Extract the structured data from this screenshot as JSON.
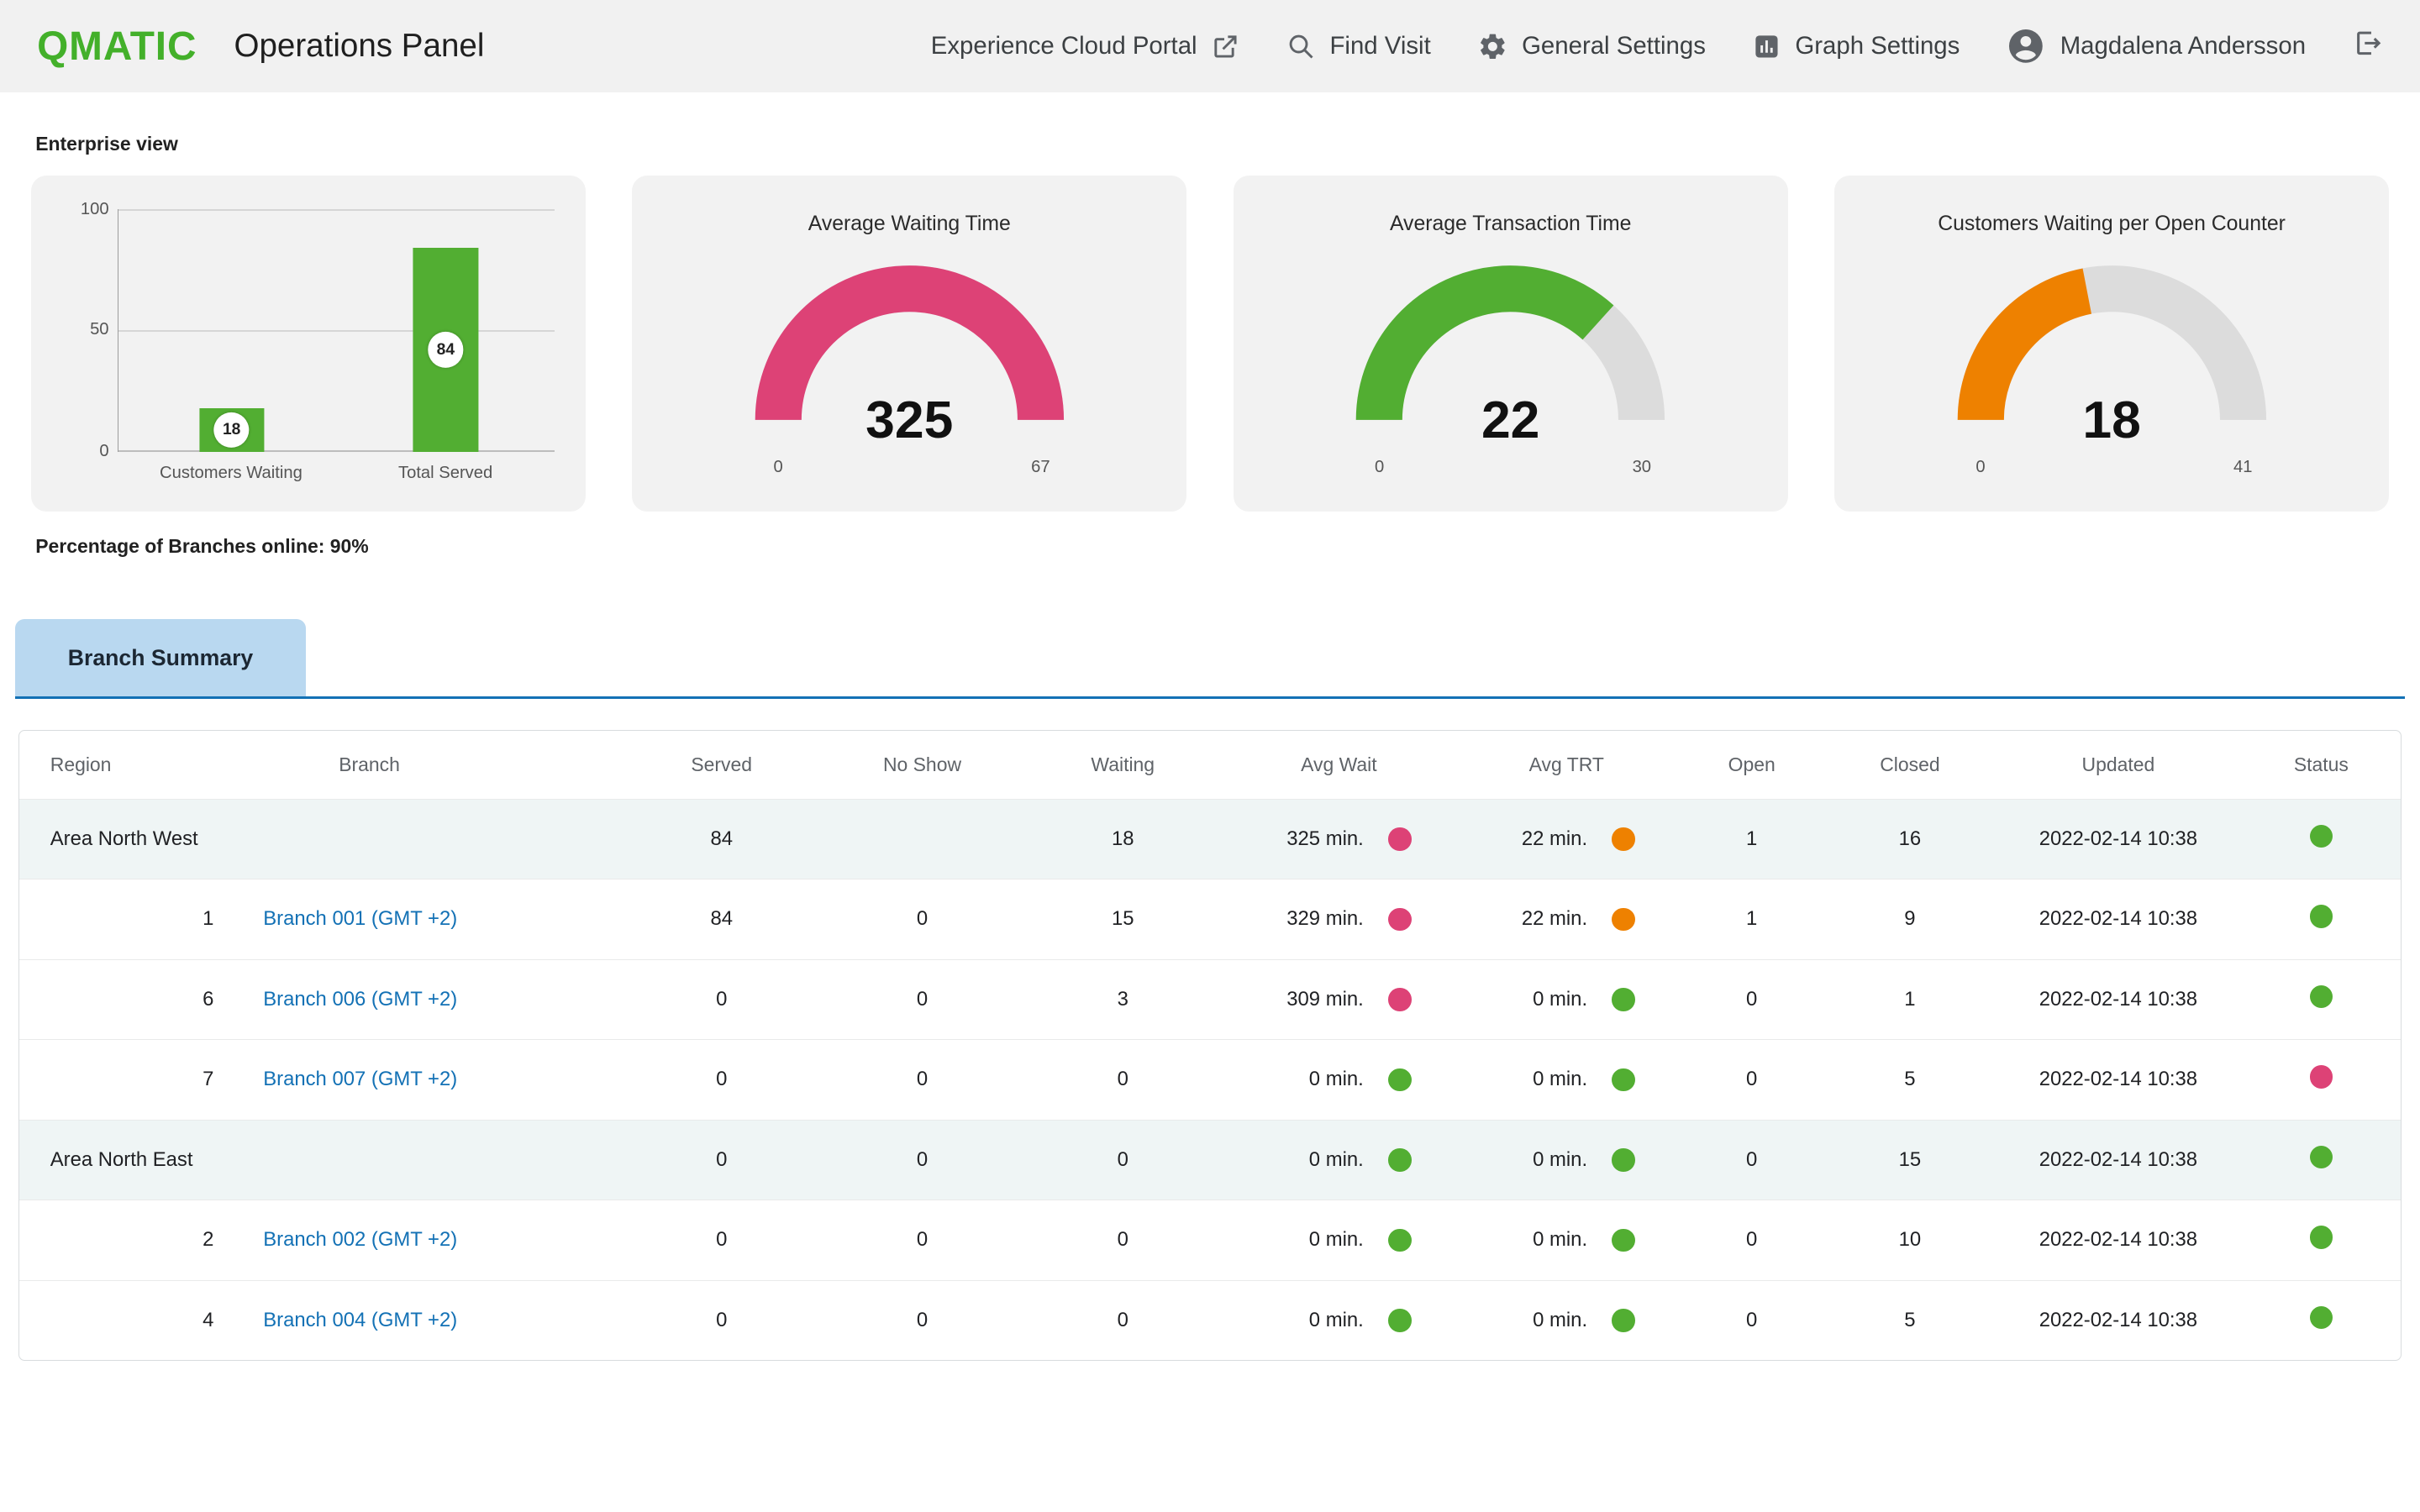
{
  "header": {
    "logo": "QMATIC",
    "title": "Operations Panel",
    "nav": [
      {
        "label": "Experience Cloud Portal",
        "icon": "external-link-icon"
      },
      {
        "label": "Find Visit",
        "icon": "search-icon"
      },
      {
        "label": "General Settings",
        "icon": "gear-icon"
      },
      {
        "label": "Graph Settings",
        "icon": "graph-settings-icon"
      }
    ],
    "user": {
      "name": "Magdalena Andersson",
      "icon": "avatar-icon"
    }
  },
  "enterprise": {
    "label": "Enterprise view",
    "online_label": "Percentage of Branches online: 90%"
  },
  "tabs": {
    "branch_summary": "Branch Summary"
  },
  "colors": {
    "brand_green": "#43b02a",
    "chart_green": "#52ae32",
    "pink": "#dd4276",
    "orange": "#ee8100",
    "link_blue": "#1371b5"
  },
  "chart_data": [
    {
      "type": "bar",
      "categories": [
        "Customers Waiting",
        "Total Served"
      ],
      "values": [
        18,
        84
      ],
      "yticks": [
        0,
        50,
        100
      ],
      "ylim": [
        0,
        100
      ],
      "bar_color": "#52ae32",
      "badges": [
        18,
        84
      ]
    },
    {
      "type": "gauge",
      "title": "Average Waiting Time",
      "value": 325,
      "min": 0,
      "max": 67,
      "color": "#dd4276"
    },
    {
      "type": "gauge",
      "title": "Average Transaction Time",
      "value": 22,
      "min": 0,
      "max": 30,
      "color": "#52ae32"
    },
    {
      "type": "gauge",
      "title": "Customers Waiting per Open Counter",
      "value": 18,
      "min": 0,
      "max": 41,
      "color": "#ee8100"
    }
  ],
  "table": {
    "columns": [
      "Region",
      "Branch",
      "Served",
      "No Show",
      "Waiting",
      "Avg Wait",
      "Avg TRT",
      "Open",
      "Closed",
      "Updated",
      "Status"
    ],
    "rows": [
      {
        "kind": "region",
        "region": "Area North West",
        "branch_no": "",
        "branch": "",
        "served": "84",
        "no_show": "",
        "waiting": "18",
        "avg_wait": "325 min.",
        "avg_wait_dot": "pink",
        "avg_trt": "22 min.",
        "avg_trt_dot": "orange",
        "open": "1",
        "closed": "16",
        "updated": "2022-02-14 10:38",
        "status_dot": "green"
      },
      {
        "kind": "branch",
        "region": "",
        "branch_no": "1",
        "branch": "Branch 001 (GMT +2)",
        "served": "84",
        "no_show": "0",
        "waiting": "15",
        "avg_wait": "329 min.",
        "avg_wait_dot": "pink",
        "avg_trt": "22 min.",
        "avg_trt_dot": "orange",
        "open": "1",
        "closed": "9",
        "updated": "2022-02-14 10:38",
        "status_dot": "green"
      },
      {
        "kind": "branch",
        "region": "",
        "branch_no": "6",
        "branch": "Branch 006 (GMT +2)",
        "served": "0",
        "no_show": "0",
        "waiting": "3",
        "avg_wait": "309 min.",
        "avg_wait_dot": "pink",
        "avg_trt": "0 min.",
        "avg_trt_dot": "green",
        "open": "0",
        "closed": "1",
        "updated": "2022-02-14 10:38",
        "status_dot": "green"
      },
      {
        "kind": "branch",
        "region": "",
        "branch_no": "7",
        "branch": "Branch 007 (GMT +2)",
        "served": "0",
        "no_show": "0",
        "waiting": "0",
        "avg_wait": "0 min.",
        "avg_wait_dot": "green",
        "avg_trt": "0 min.",
        "avg_trt_dot": "green",
        "open": "0",
        "closed": "5",
        "updated": "2022-02-14 10:38",
        "status_dot": "pink"
      },
      {
        "kind": "region",
        "region": "Area North East",
        "branch_no": "",
        "branch": "",
        "served": "0",
        "no_show": "0",
        "waiting": "0",
        "avg_wait": "0 min.",
        "avg_wait_dot": "green",
        "avg_trt": "0 min.",
        "avg_trt_dot": "green",
        "open": "0",
        "closed": "15",
        "updated": "2022-02-14 10:38",
        "status_dot": "green"
      },
      {
        "kind": "branch",
        "region": "",
        "branch_no": "2",
        "branch": "Branch 002 (GMT +2)",
        "served": "0",
        "no_show": "0",
        "waiting": "0",
        "avg_wait": "0 min.",
        "avg_wait_dot": "green",
        "avg_trt": "0 min.",
        "avg_trt_dot": "green",
        "open": "0",
        "closed": "10",
        "updated": "2022-02-14 10:38",
        "status_dot": "green"
      },
      {
        "kind": "branch",
        "region": "",
        "branch_no": "4",
        "branch": "Branch 004 (GMT +2)",
        "served": "0",
        "no_show": "0",
        "waiting": "0",
        "avg_wait": "0 min.",
        "avg_wait_dot": "green",
        "avg_trt": "0 min.",
        "avg_trt_dot": "green",
        "open": "0",
        "closed": "5",
        "updated": "2022-02-14 10:38",
        "status_dot": "green"
      }
    ]
  }
}
